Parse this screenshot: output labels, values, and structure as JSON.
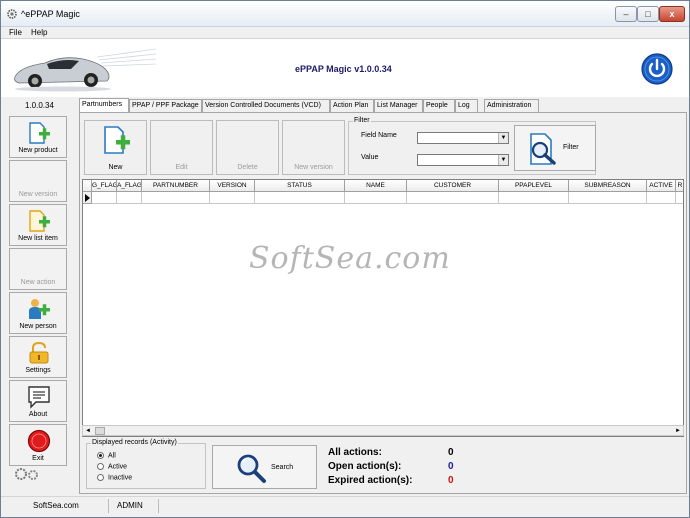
{
  "window": {
    "title": "^ePPAP Magic",
    "min_label": "–",
    "max_label": "□",
    "close_label": "x"
  },
  "menu": [
    "File",
    "Help"
  ],
  "header": {
    "app_title": "ePPAP Magic v1.0.0.34"
  },
  "version": "1.0.0.34",
  "sidebar": {
    "items": [
      {
        "label": "New product",
        "enabled": true,
        "icon": "new-product-icon"
      },
      {
        "label": "New version",
        "enabled": false,
        "icon": "none"
      },
      {
        "label": "New list item",
        "enabled": true,
        "icon": "new-list-item-icon"
      },
      {
        "label": "New action",
        "enabled": false,
        "icon": "none"
      },
      {
        "label": "New person",
        "enabled": true,
        "icon": "new-person-icon"
      },
      {
        "label": "Settings",
        "enabled": true,
        "icon": "lock-icon"
      },
      {
        "label": "About",
        "enabled": true,
        "icon": "chat-bubble-icon"
      },
      {
        "label": "Exit",
        "enabled": true,
        "icon": "red-circle-icon"
      }
    ]
  },
  "tabs": [
    {
      "label": "Partnumbers",
      "active": true
    },
    {
      "label": "PPAP / PPF Package",
      "active": false
    },
    {
      "label": "Version Controlled Documents (VCD)",
      "active": false
    },
    {
      "label": "Action Plan",
      "active": false
    },
    {
      "label": "List Manager",
      "active": false
    },
    {
      "label": "People",
      "active": false
    },
    {
      "label": "Log",
      "active": false
    },
    {
      "label": "Administration",
      "active": false
    }
  ],
  "actions": {
    "new": "New",
    "edit": "Edit",
    "delete": "Delete",
    "new_version": "New version"
  },
  "filter": {
    "legend": "Filter",
    "field_name_label": "Field Name",
    "value_label": "Value",
    "field_name_value": "",
    "value_value": "",
    "button_label": "Filter"
  },
  "grid": {
    "columns": [
      "G_FLAG",
      "A_FLAG",
      "PARTNUMBER",
      "VERSION",
      "STATUS",
      "NAME",
      "CUSTOMER",
      "PPAPLEVEL",
      "SUBMREASON",
      "ACTIVE",
      "R"
    ]
  },
  "watermark": "SoftSea.com",
  "records": {
    "legend": "Displayed records (Activity)",
    "options": [
      "All",
      "Active",
      "Inactive"
    ],
    "selected": "All"
  },
  "search": {
    "label": "Search"
  },
  "stats": {
    "all_label": "All actions:",
    "all_value": "0",
    "open_label": "Open action(s):",
    "open_value": "0",
    "expired_label": "Expired action(s):",
    "expired_value": "0",
    "colors": {
      "all": "#000000",
      "open": "#1a1a9a",
      "expired": "#cc1111"
    }
  },
  "statusbar": {
    "site": "SoftSea.com",
    "user": "ADMIN"
  }
}
